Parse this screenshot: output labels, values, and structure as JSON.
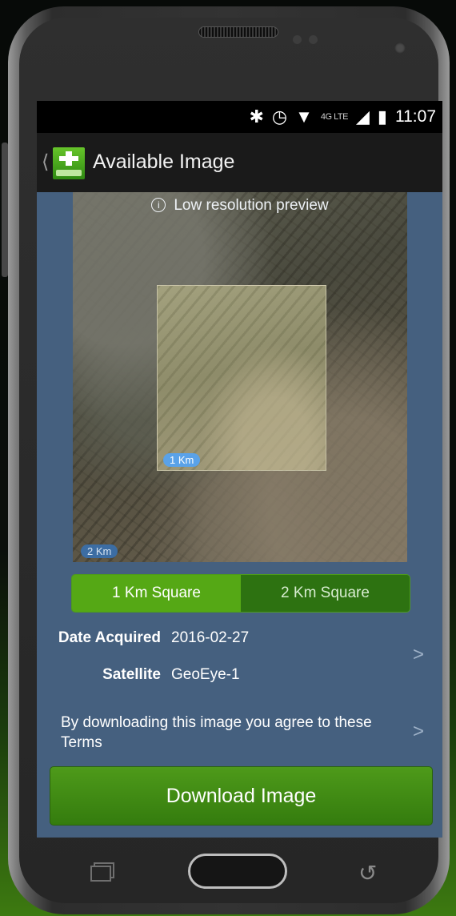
{
  "status_bar": {
    "icons": [
      "bluetooth-icon",
      "alarm-icon",
      "wifi-icon",
      "4g-lte-icon",
      "signal-icon",
      "battery-icon"
    ],
    "network_label": "4G LTE",
    "time": "11:07"
  },
  "action_bar": {
    "title": "Available Image",
    "app_icon": "satellite-app-icon"
  },
  "preview": {
    "note": "Low resolution preview",
    "scale_1km": "1 Km",
    "scale_2km": "2 Km"
  },
  "segments": [
    {
      "label": "1 Km Square",
      "selected": true
    },
    {
      "label": "2 Km Square",
      "selected": false
    }
  ],
  "details": {
    "date_label": "Date Acquired",
    "date_value": "2016-02-27",
    "satellite_label": "Satellite",
    "satellite_value": "GeoEye-1",
    "chevron": ">"
  },
  "terms": {
    "text": "By downloading this image you agree to these Terms",
    "chevron": ">"
  },
  "download_button": "Download Image",
  "colors": {
    "screen_bg": "#45607f",
    "accent_green": "#55a815",
    "dark_green": "#2d7211",
    "scale_chip": "#5aa2e8"
  }
}
